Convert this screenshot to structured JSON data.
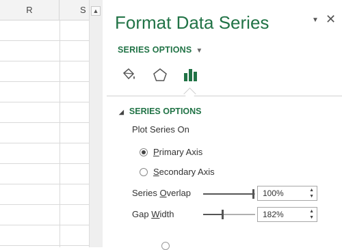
{
  "sheet": {
    "columns": [
      "R",
      "S"
    ]
  },
  "pane": {
    "title": "Format Data Series",
    "menu_icon": "pane-options-caret",
    "close_icon": "close-x",
    "options_dropdown": "SERIES OPTIONS",
    "tabs": [
      {
        "name": "Fill & Line",
        "icon": "paint-bucket-icon"
      },
      {
        "name": "Effects",
        "icon": "pentagon-icon"
      },
      {
        "name": "Series Options",
        "icon": "bar-chart-icon",
        "active": true
      }
    ],
    "section": {
      "heading": "SERIES OPTIONS",
      "plot_series_on": "Plot Series On",
      "primary_axis": "Primary Axis",
      "secondary_axis": "Secondary Axis",
      "selected_axis": "Primary Axis",
      "series_overlap_label": "Series Overlap",
      "series_overlap_value": "100%",
      "series_overlap_fraction": 1.0,
      "gap_width_label": "Gap Width",
      "gap_width_value": "182%",
      "gap_width_fraction": 0.364
    }
  },
  "colors": {
    "accent": "#217346"
  }
}
